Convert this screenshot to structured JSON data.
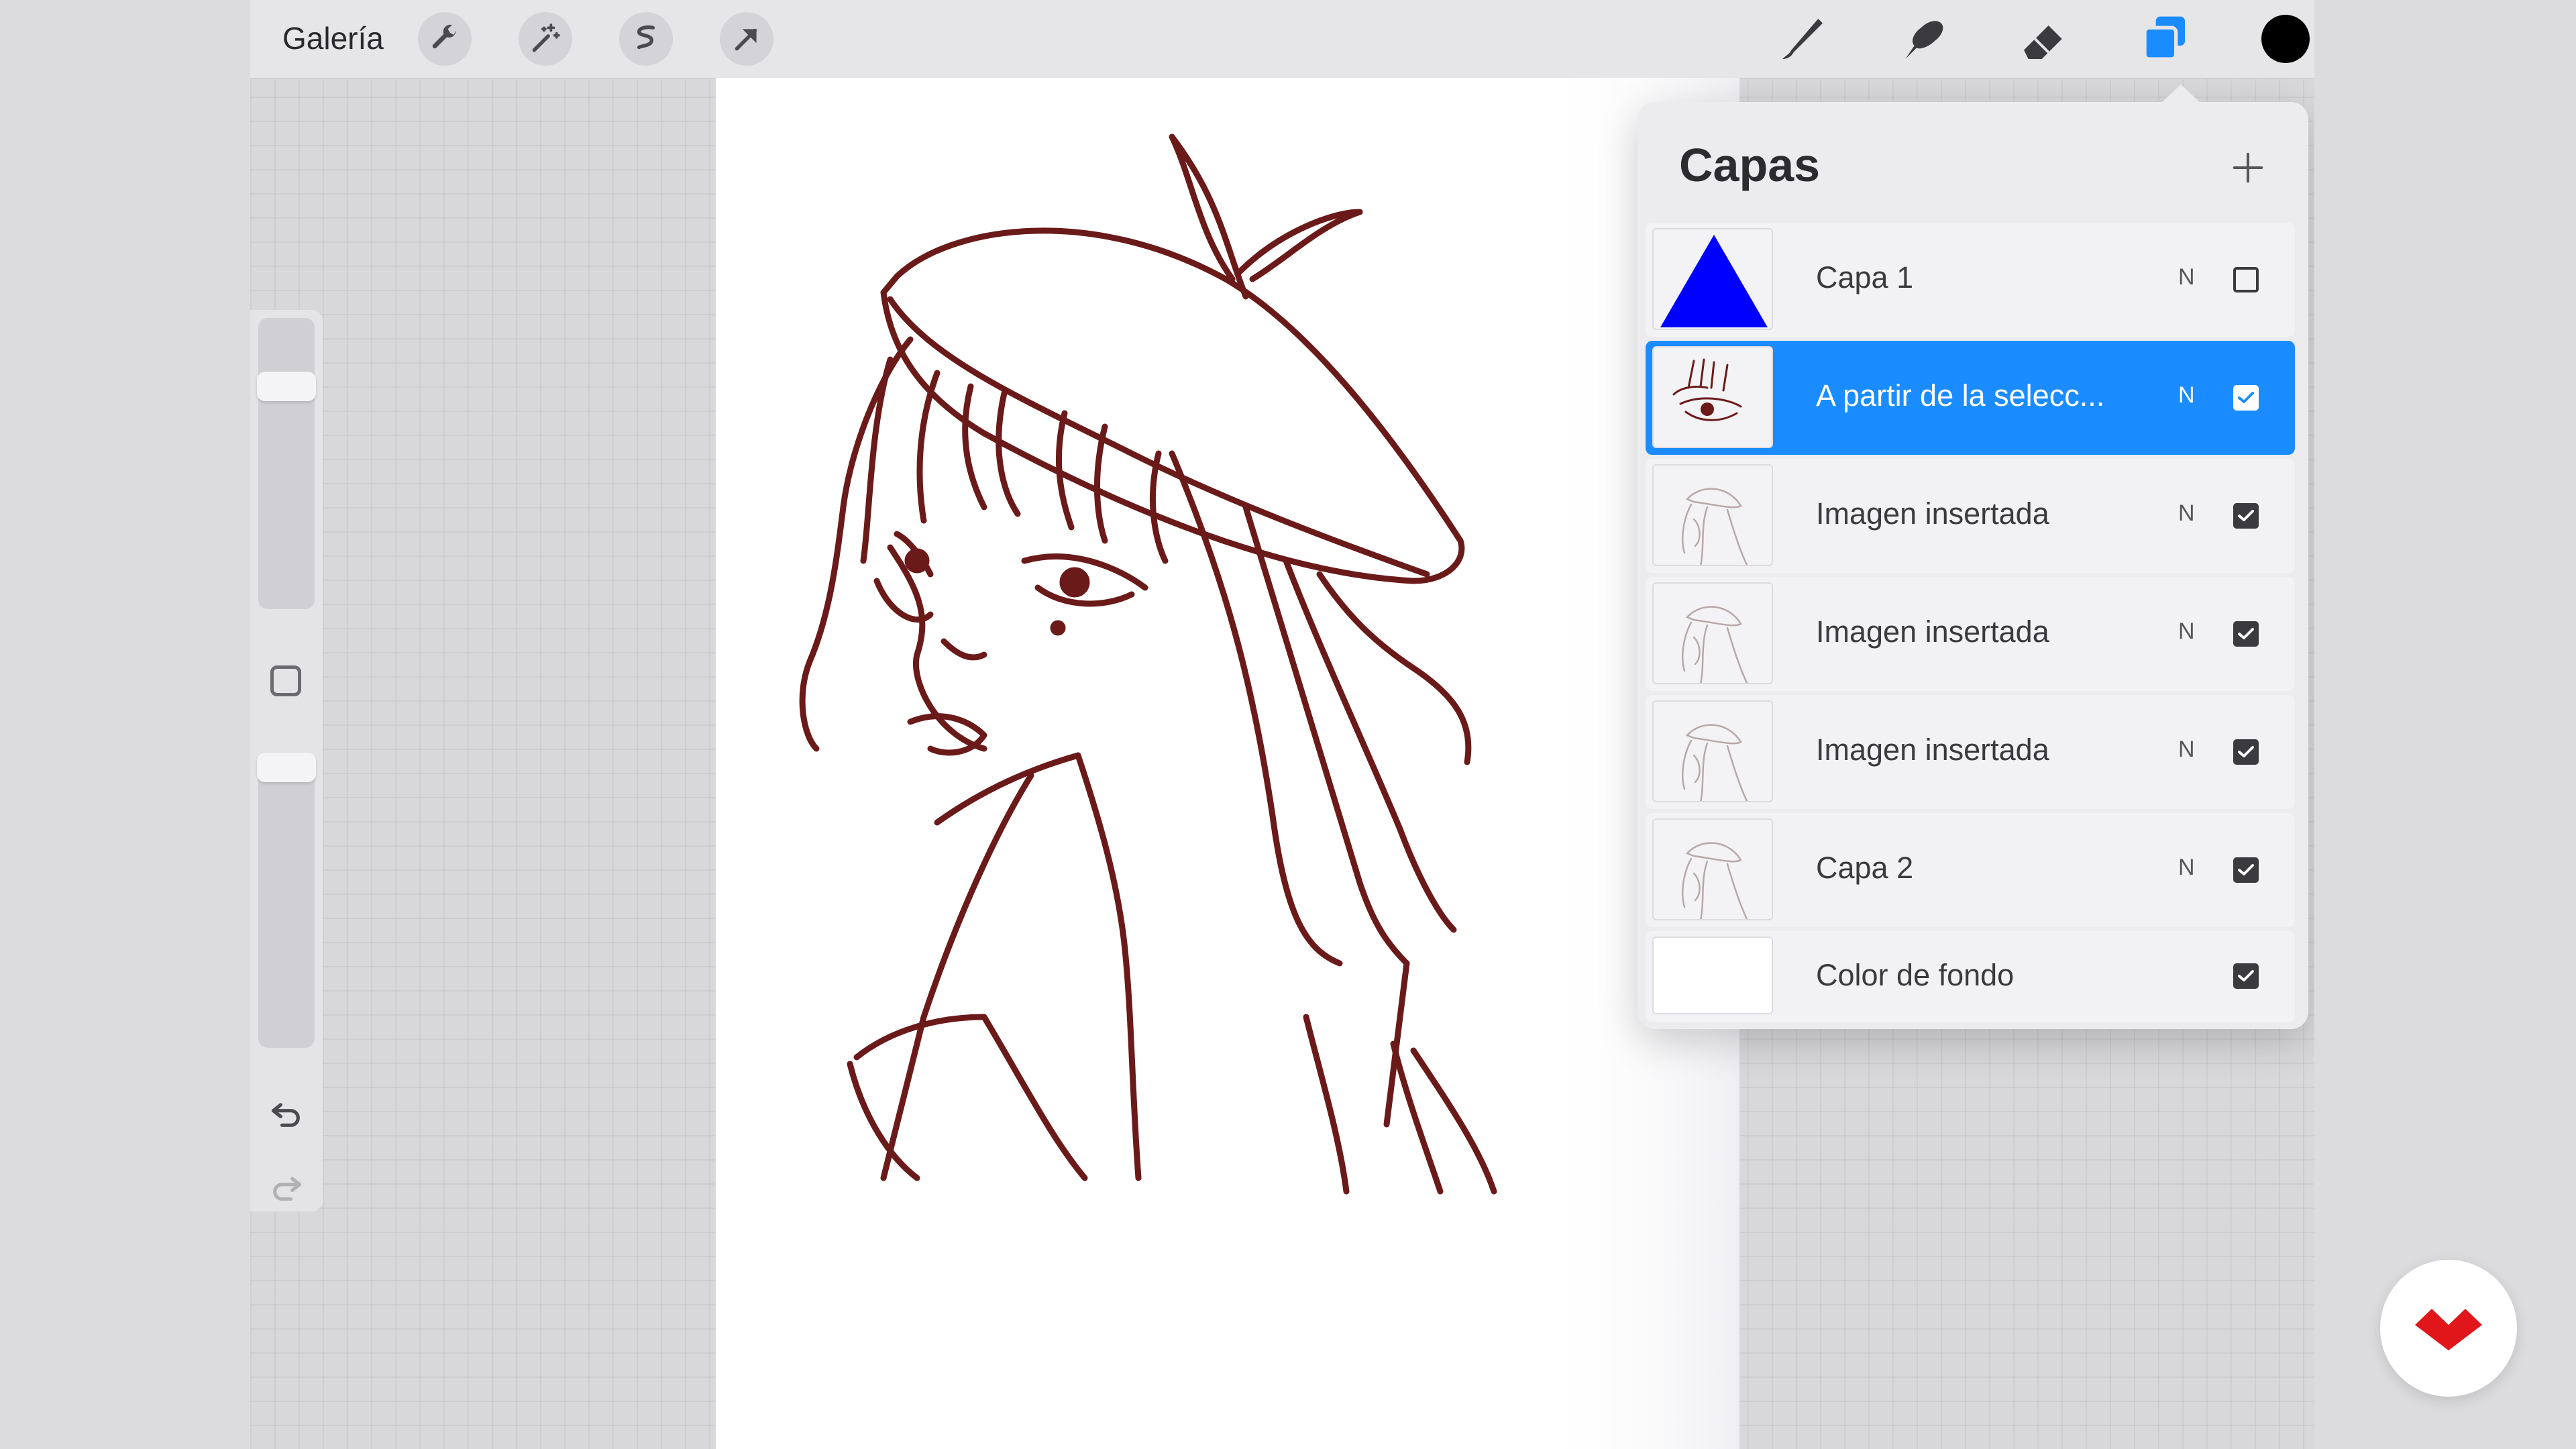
{
  "topbar": {
    "gallery_label": "Galería",
    "left_tools": [
      "wrench-icon",
      "magic-wand-icon",
      "selection-icon",
      "transform-arrow-icon"
    ],
    "right_tools": [
      "brush-icon",
      "smudge-icon",
      "eraser-icon",
      "layers-icon",
      "color-icon"
    ],
    "active_color": "#000000",
    "accent": "#1a8cff"
  },
  "layers_panel": {
    "title": "Capas",
    "add_icon": "plus-icon",
    "layers": [
      {
        "name": "Capa 1",
        "mode": "N",
        "visible": false,
        "thumb": "blue-triangle"
      },
      {
        "name": "A partir de la selecc...",
        "mode": "N",
        "visible": true,
        "selected": true,
        "thumb": "eye-sketch"
      },
      {
        "name": "Imagen insertada",
        "mode": "N",
        "visible": true,
        "thumb": "girl-sketch"
      },
      {
        "name": "Imagen insertada",
        "mode": "N",
        "visible": true,
        "thumb": "girl-sketch"
      },
      {
        "name": "Imagen insertada",
        "mode": "N",
        "visible": true,
        "thumb": "girl-sketch"
      },
      {
        "name": "Capa 2",
        "mode": "N",
        "visible": true,
        "thumb": "girl-sketch"
      },
      {
        "name": "Color de fondo",
        "mode": "",
        "visible": true,
        "thumb": "white"
      }
    ]
  },
  "sidebar": {
    "items": [
      "brush-size-slider",
      "modify-button",
      "opacity-slider",
      "undo-icon",
      "redo-icon"
    ]
  },
  "stroke_color": "#6b1a1a"
}
